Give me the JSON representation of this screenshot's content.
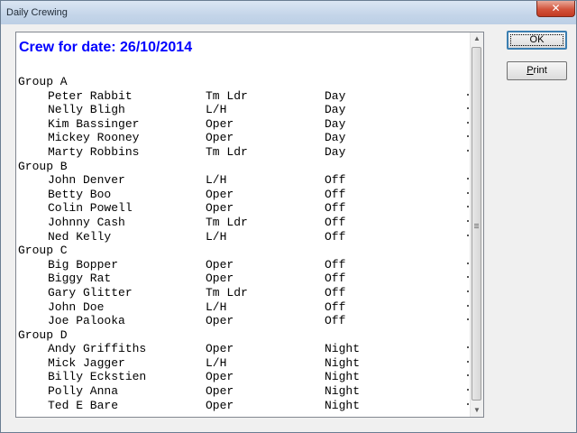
{
  "window": {
    "title": "Daily Crewing",
    "close_glyph": "✕"
  },
  "report": {
    "title": "Crew for date: 26/10/2014",
    "groups": [
      {
        "label": "Group A",
        "members": [
          {
            "name": "Peter Rabbit",
            "role": "Tm Ldr",
            "shift": "Day"
          },
          {
            "name": "Nelly Bligh",
            "role": "L/H",
            "shift": "Day"
          },
          {
            "name": "Kim Bassinger",
            "role": "Oper",
            "shift": "Day"
          },
          {
            "name": "Mickey Rooney",
            "role": "Oper",
            "shift": "Day"
          },
          {
            "name": "Marty Robbins",
            "role": "Tm Ldr",
            "shift": "Day"
          }
        ]
      },
      {
        "label": "Group B",
        "members": [
          {
            "name": "John Denver",
            "role": "L/H",
            "shift": "Off"
          },
          {
            "name": "Betty Boo",
            "role": "Oper",
            "shift": "Off"
          },
          {
            "name": "Colin Powell",
            "role": "Oper",
            "shift": "Off"
          },
          {
            "name": "Johnny Cash",
            "role": "Tm Ldr",
            "shift": "Off"
          },
          {
            "name": "Ned Kelly",
            "role": "L/H",
            "shift": "Off"
          }
        ]
      },
      {
        "label": "Group C",
        "members": [
          {
            "name": "Big Bopper",
            "role": "Oper",
            "shift": "Off"
          },
          {
            "name": "Biggy Rat",
            "role": "Oper",
            "shift": "Off"
          },
          {
            "name": "Gary Glitter",
            "role": "Tm Ldr",
            "shift": "Off"
          },
          {
            "name": "John Doe",
            "role": "L/H",
            "shift": "Off"
          },
          {
            "name": "Joe Palooka",
            "role": "Oper",
            "shift": "Off"
          }
        ]
      },
      {
        "label": "Group D",
        "members": [
          {
            "name": "Andy Griffiths",
            "role": "Oper",
            "shift": "Night"
          },
          {
            "name": "Mick Jagger",
            "role": "L/H",
            "shift": "Night"
          },
          {
            "name": "Billy Eckstien",
            "role": "Oper",
            "shift": "Night"
          },
          {
            "name": "Polly Anna",
            "role": "Oper",
            "shift": "Night"
          },
          {
            "name": "Ted E Bare",
            "role": "Oper",
            "shift": "Night"
          }
        ]
      }
    ]
  },
  "scrollbar": {
    "up_arrow": "▲",
    "down_arrow": "▼"
  },
  "buttons": {
    "ok_label": "OK",
    "print_mnemonic": "P",
    "print_rest": "rint"
  }
}
